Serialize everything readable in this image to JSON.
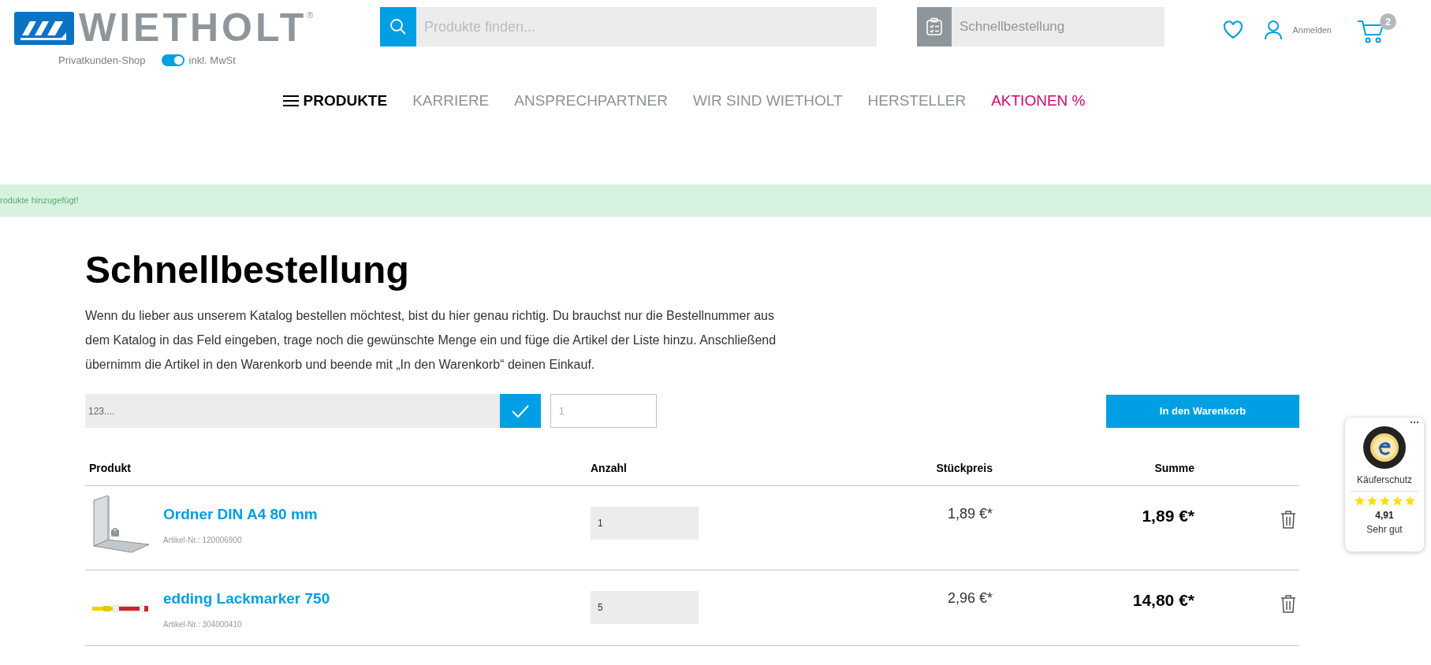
{
  "header": {
    "logo_text": "WIETHOLT",
    "registered_mark": "®",
    "shop_label": "Privatkunden-Shop",
    "vat_toggle": {
      "label": "inkl. MwSt",
      "on": true
    },
    "search": {
      "placeholder": "Produkte finden..."
    },
    "quick_order": {
      "placeholder": "Schnellbestellung"
    },
    "account_label": "Anmelden",
    "cart_count": "2"
  },
  "nav": [
    {
      "label": "PRODUKTE",
      "kind": "menu"
    },
    {
      "label": "KARRIERE",
      "kind": "link"
    },
    {
      "label": "ANSPRECHPARTNER",
      "kind": "link"
    },
    {
      "label": "WIR SIND WIETHOLT",
      "kind": "link"
    },
    {
      "label": "HERSTELLER",
      "kind": "link"
    },
    {
      "label": "AKTIONEN %",
      "kind": "promo"
    }
  ],
  "notice": "rodukte hinzugefügt!",
  "page": {
    "title": "Schnellbestellung",
    "intro": "Wenn du lieber aus unserem Katalog bestellen möchtest, bist du hier genau richtig. Du brauchst nur die Bestellnummer aus dem Katalog in das Feld eingeben, trage noch die gewünschte Menge ein und füge die Artikel der Liste hinzu. Anschließend übernimm die Artikel in den Warenkorb und beende mit „In den Warenkorb“ deinen Einkauf.",
    "order_form": {
      "article_placeholder": "123....",
      "quantity_placeholder": "1",
      "submit_label": "In den Warenkorb"
    }
  },
  "table": {
    "columns": [
      "Produkt",
      "Anzahl",
      "Stückpreis",
      "Summe"
    ],
    "rows": [
      {
        "name": "Ordner DIN A4 80 mm",
        "article_no": "Artikel-Nr.: 120006900",
        "quantity": "1",
        "unit_price": "1,89 €*",
        "total": "1,89 €*"
      },
      {
        "name": "edding Lackmarker 750",
        "article_no": "Artikel-Nr.: 304000410",
        "quantity": "5",
        "unit_price": "2,96 €*",
        "total": "14,80 €*"
      }
    ]
  },
  "trust_badge": {
    "label": "Käuferschutz",
    "stars": 5,
    "rating": "4,91",
    "verdict": "Sehr gut"
  }
}
